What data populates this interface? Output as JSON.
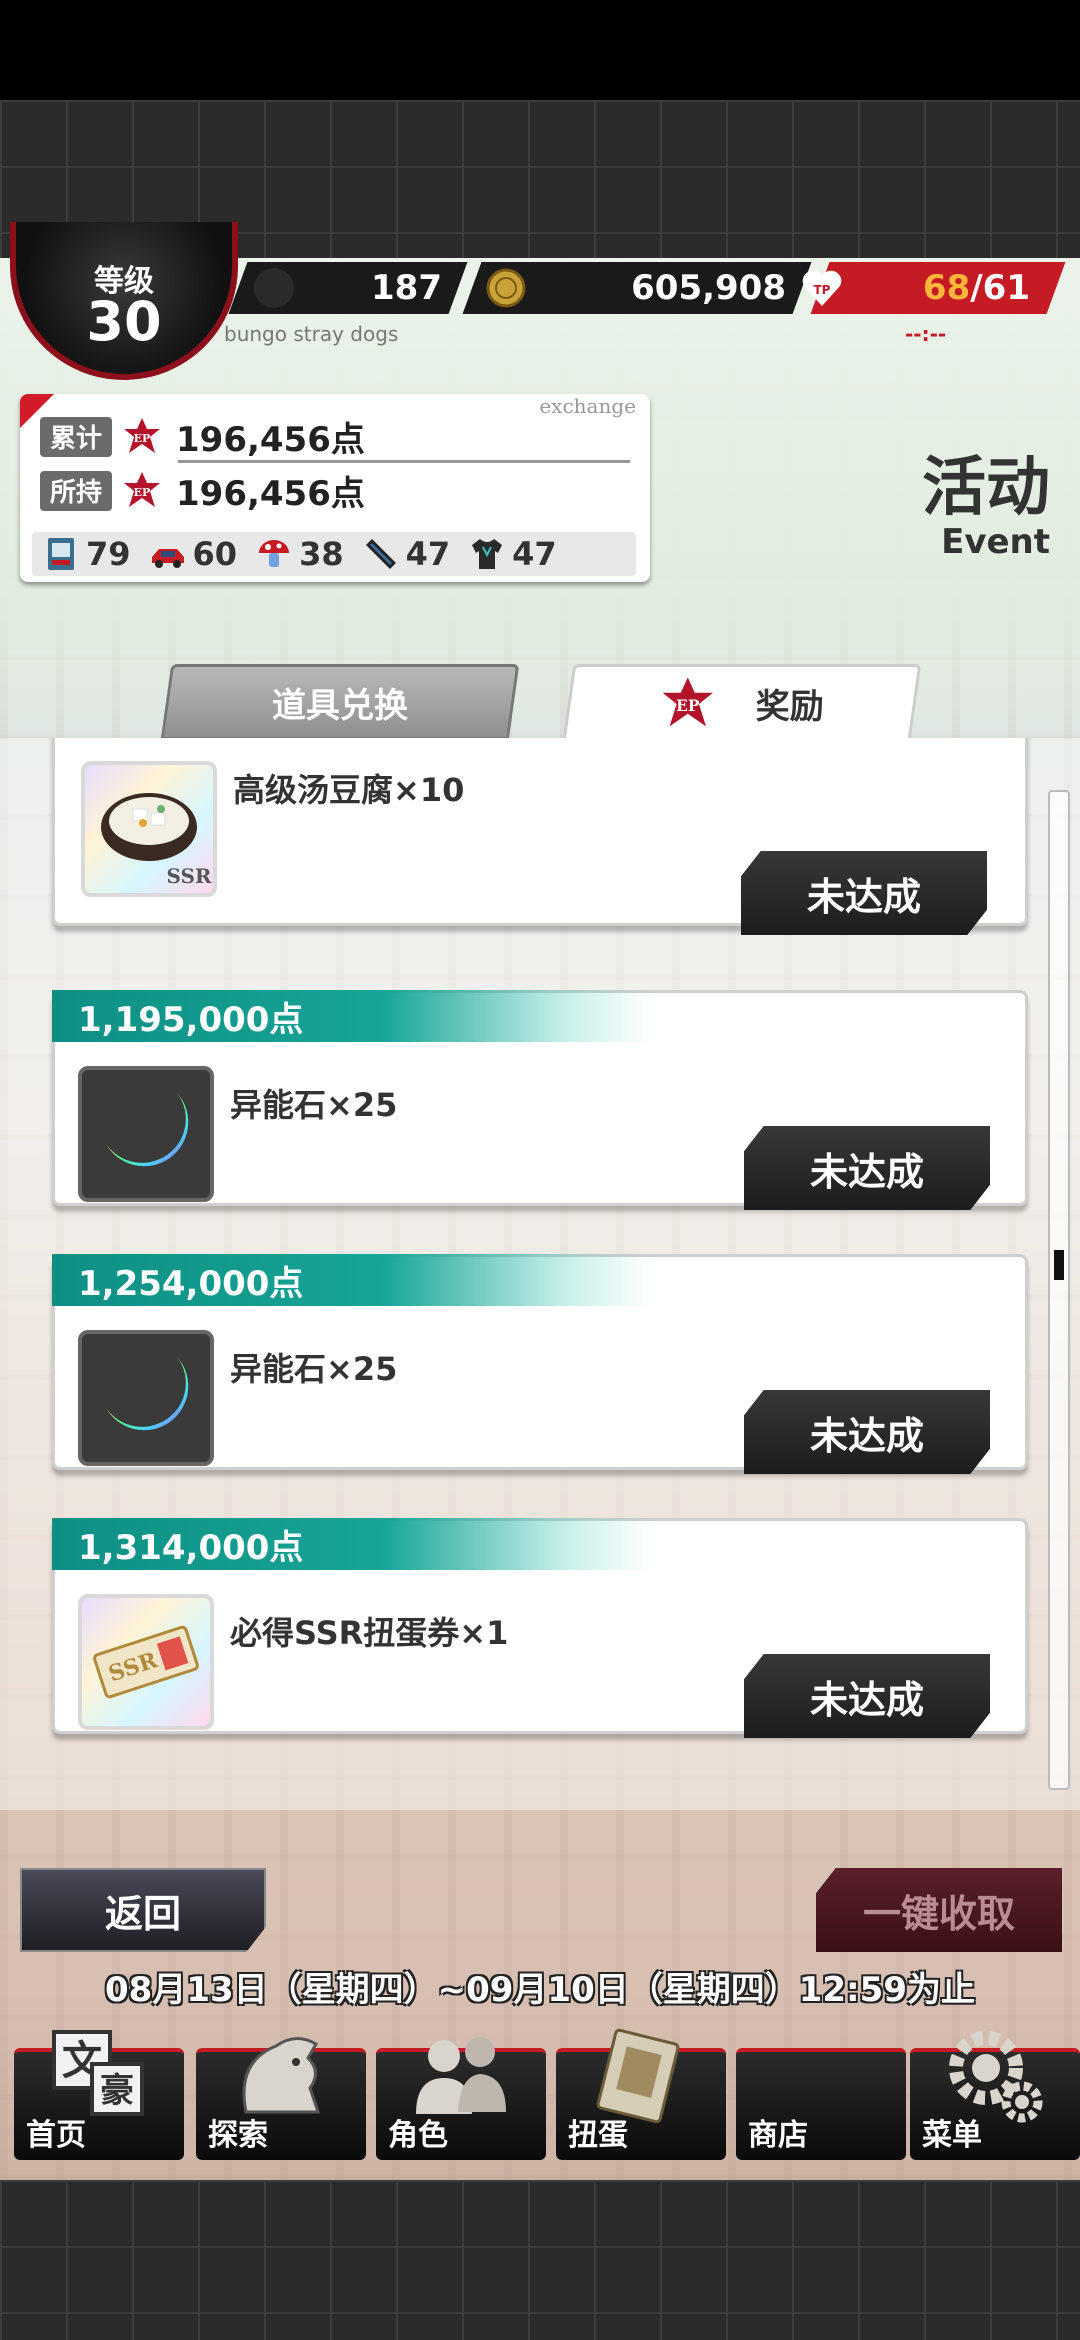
{
  "header": {
    "level_label": "等级",
    "level_value": "30",
    "stones": "187",
    "coins": "605,908",
    "stamina_current": "68",
    "stamina_max": "61",
    "stamina_timer": "--:--",
    "game_subtitle": "bungo stray dogs"
  },
  "ep_panel": {
    "exchange_label": "exchange",
    "total_label": "累计",
    "total_value": "196,456点",
    "held_label": "所持",
    "held_value": "196,456点",
    "inventory": [
      {
        "icon": "ticket-icon",
        "count": "79"
      },
      {
        "icon": "red-car-icon",
        "count": "60"
      },
      {
        "icon": "mushroom-icon",
        "count": "38"
      },
      {
        "icon": "tie-icon",
        "count": "47"
      },
      {
        "icon": "shirt-icon",
        "count": "47"
      }
    ]
  },
  "page_title": {
    "cn": "活动",
    "en": "Event"
  },
  "tabs": {
    "exchange": "道具兑换",
    "reward": "奖励"
  },
  "rewards": [
    {
      "threshold": "",
      "name": "高级汤豆腐×10",
      "rarity": "SSR",
      "status": "未达成"
    },
    {
      "threshold": "1,195,000点",
      "name": "异能石×25",
      "status": "未达成"
    },
    {
      "threshold": "1,254,000点",
      "name": "异能石×25",
      "status": "未达成"
    },
    {
      "threshold": "1,314,000点",
      "name": "必得SSR扭蛋券×1",
      "status": "未达成"
    }
  ],
  "actions": {
    "back": "返回",
    "collect_all": "一键收取"
  },
  "event_period": "08月13日（星期四）~09月10日（星期四）12:59为止",
  "nav": [
    {
      "label": "首页",
      "icon": "home-icon"
    },
    {
      "label": "探索",
      "icon": "explore-icon"
    },
    {
      "label": "角色",
      "icon": "characters-icon"
    },
    {
      "label": "扭蛋",
      "icon": "gacha-icon"
    },
    {
      "label": "商店",
      "icon": "shop-icon"
    },
    {
      "label": "菜单",
      "icon": "menu-gear-icon"
    }
  ],
  "colors": {
    "accent_red": "#c51b25",
    "teal": "#16a596",
    "dark_button": "#2a2a2a"
  }
}
